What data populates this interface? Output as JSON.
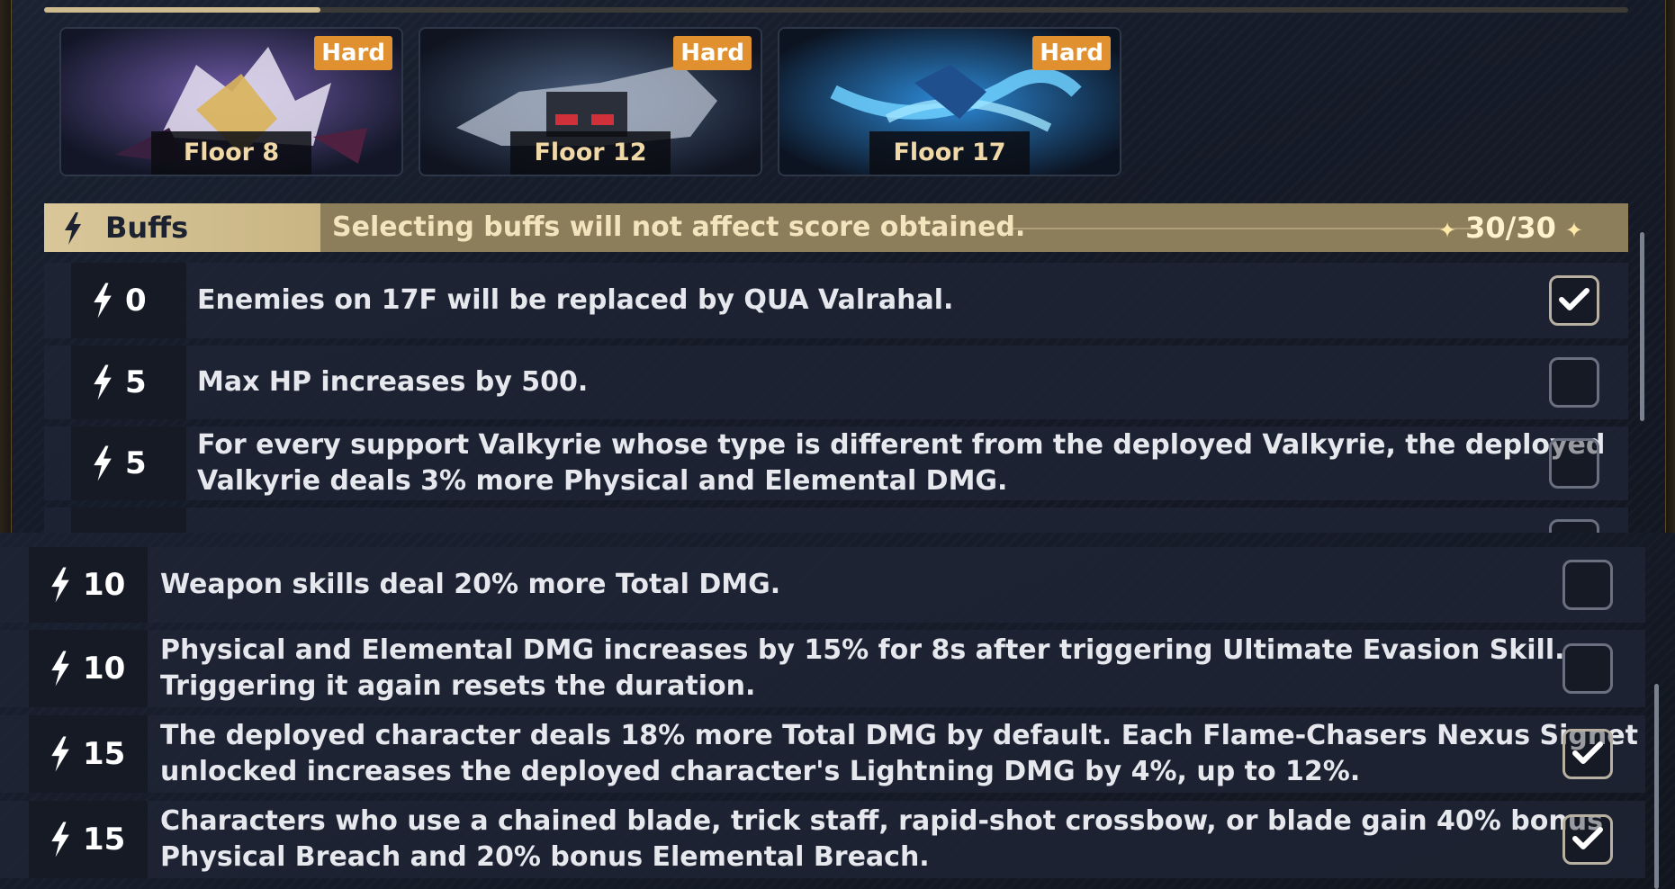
{
  "floors": [
    {
      "badge": "Hard",
      "label": "Floor 8"
    },
    {
      "badge": "Hard",
      "label": "Floor 12"
    },
    {
      "badge": "Hard",
      "label": "Floor 17"
    }
  ],
  "buffs": {
    "tab_label": "Buffs",
    "note": "Selecting buffs will not affect score obtained.",
    "count": "30/30",
    "star": "✦"
  },
  "upper_rows": [
    {
      "cost": "0",
      "desc": "Enemies on 17F will be replaced by QUA Valrahal.",
      "checked": true
    },
    {
      "cost": "5",
      "desc": "Max HP increases by 500.",
      "checked": false
    },
    {
      "cost": "5",
      "desc": "For every support Valkyrie whose type is different from the deployed Valkyrie, the deployed\nValkyrie deals 3% more Physical and Elemental DMG.",
      "checked": false
    }
  ],
  "lower_rows": [
    {
      "cost": "10",
      "desc": "Weapon skills deal 20% more Total DMG.",
      "checked": false
    },
    {
      "cost": "10",
      "desc": "Physical and Elemental DMG increases by 15% for 8s after triggering Ultimate Evasion Skill.\nTriggering it again resets the duration.",
      "checked": false
    },
    {
      "cost": "15",
      "desc": "The deployed character deals 18% more Total DMG by default. Each Flame-Chasers Nexus Signet\nunlocked increases the deployed character's Lightning DMG by 4%, up to 12%.",
      "checked": true
    },
    {
      "cost": "15",
      "desc": "Characters who use a chained blade, trick staff, rapid-shot crossbow, or blade gain 40% bonus\nPhysical Breach and 20% bonus Elemental Breach.",
      "checked": true
    }
  ],
  "icons": {
    "cost": "lightning-bolt-icon",
    "check": "checkmark-icon"
  },
  "colors": {
    "badge": "#e0902f",
    "gold": "#cdbb8f",
    "floor_label": "#f0d9a6"
  }
}
